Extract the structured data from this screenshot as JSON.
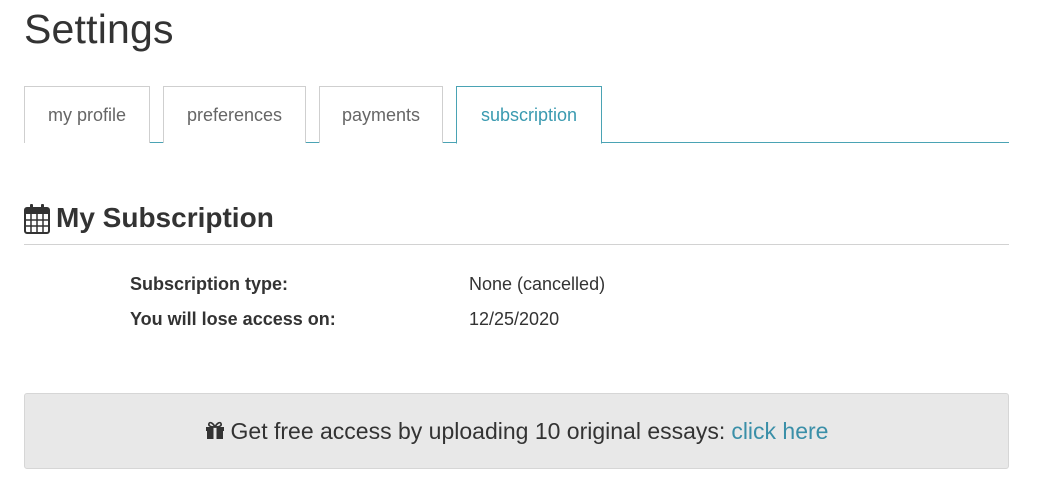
{
  "page": {
    "title": "Settings"
  },
  "tabs": [
    {
      "label": "my profile",
      "active": false
    },
    {
      "label": "preferences",
      "active": false
    },
    {
      "label": "payments",
      "active": false
    },
    {
      "label": "subscription",
      "active": true
    }
  ],
  "section": {
    "icon": "calendar-icon",
    "title": "My Subscription"
  },
  "details": [
    {
      "label": "Subscription type:",
      "value": "None (cancelled)"
    },
    {
      "label": "You will lose access on:",
      "value": "12/25/2020"
    }
  ],
  "banner": {
    "icon": "gift-icon",
    "text": "Get free access by uploading 10 original essays:",
    "link_label": "click here"
  },
  "colors": {
    "accent": "#3a9ab0",
    "link": "#3a8fa8",
    "banner_bg": "#e8e8e8"
  }
}
